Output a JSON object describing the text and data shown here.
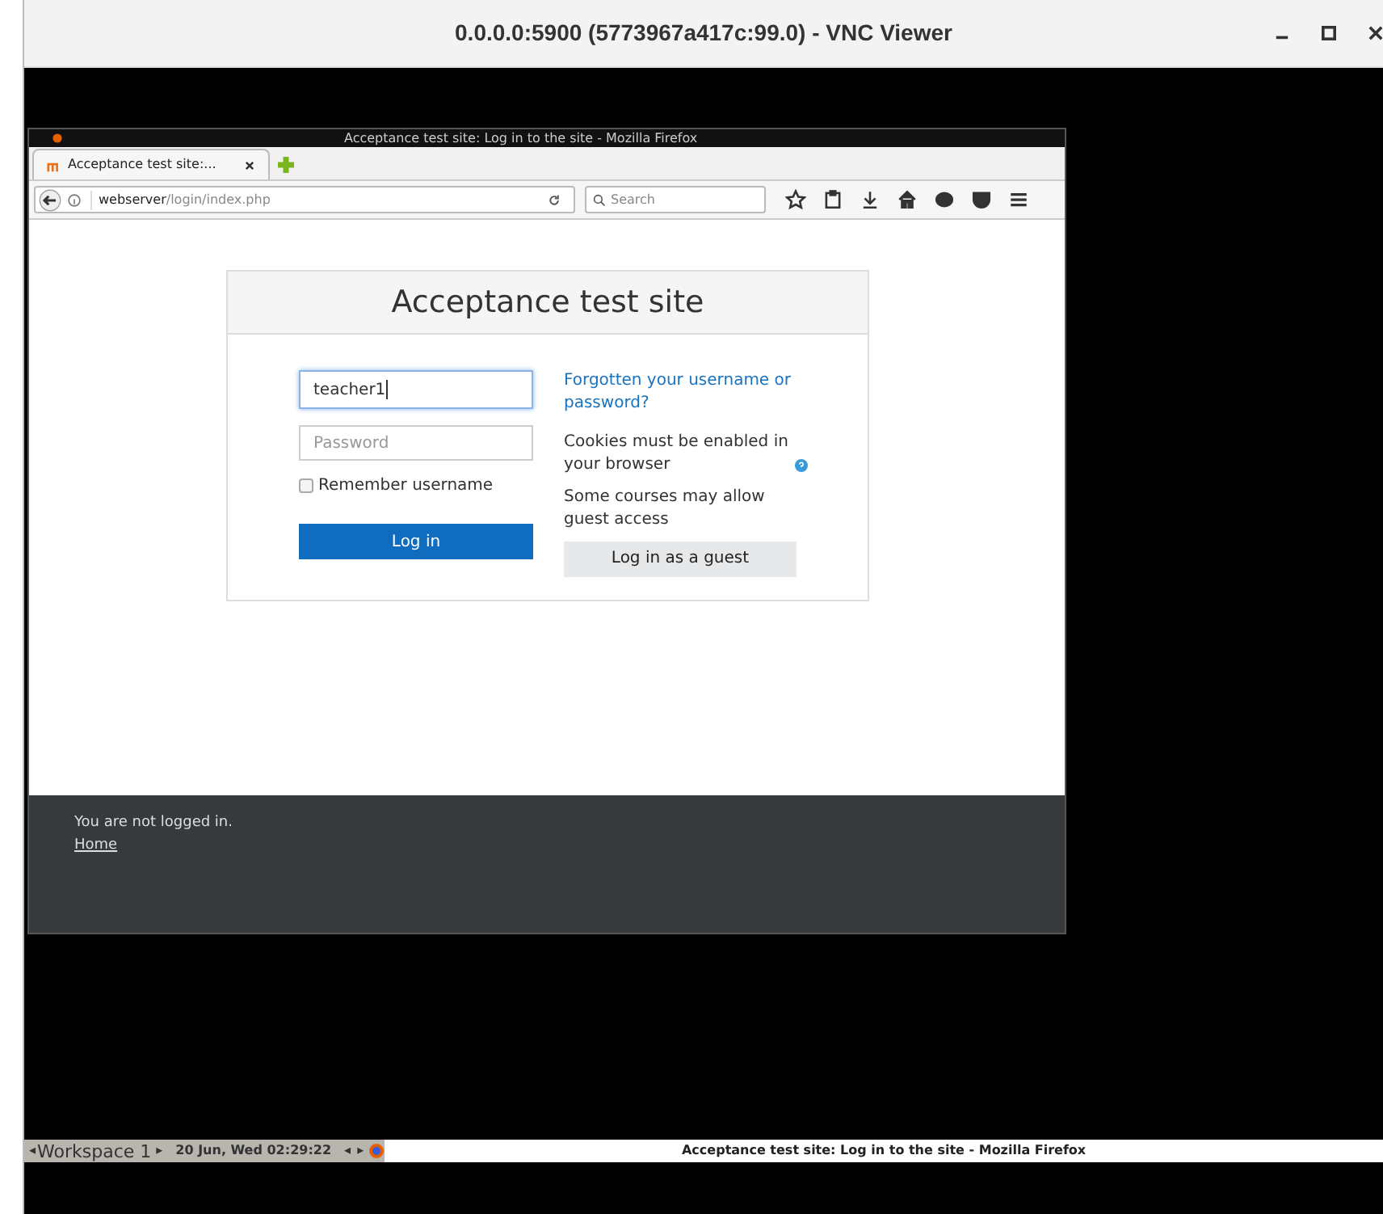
{
  "vnc_window": {
    "title": "0.0.0.0:5900 (5773967a417c:99.0) - VNC Viewer"
  },
  "firefox": {
    "title": "Acceptance test site: Log in to the site - Mozilla Firefox",
    "tabs": [
      {
        "label": "Acceptance test site:...",
        "selected": true
      }
    ],
    "url": {
      "host": "webserver",
      "path": "/login/index.php"
    },
    "search": {
      "placeholder": "Search"
    }
  },
  "login": {
    "heading": "Acceptance test site",
    "username": {
      "value": "teacher1",
      "focused": true
    },
    "password": {
      "placeholder": "Password"
    },
    "remember": {
      "label": "Remember username",
      "checked": false
    },
    "login_button": "Log in",
    "forgot_link": "Forgotten your username or password?",
    "cookies_note": "Cookies must be enabled in your browser",
    "guest_note": "Some courses may allow guest access",
    "guest_button": "Log in as a guest"
  },
  "footer": {
    "status": "You are not logged in.",
    "home_link": "Home"
  },
  "taskbar": {
    "prev_arrow": "◂",
    "workspace": "Workspace 1",
    "next_arrow": "▸",
    "datetime": "20 Jun, Wed 02:29:22",
    "left_arrow": "◂",
    "right_arrow": "▸",
    "active_window": "Acceptance test site: Log in to the site - Mozilla Firefox"
  }
}
